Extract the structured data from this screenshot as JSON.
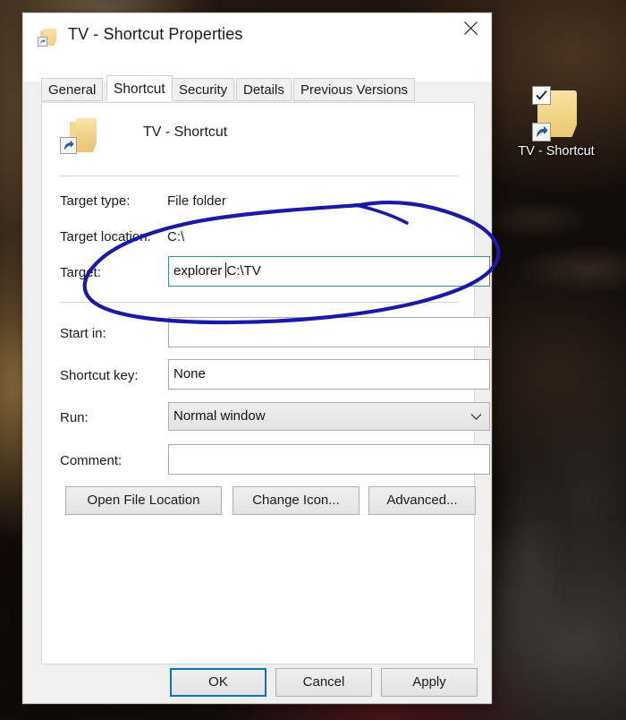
{
  "desktop": {
    "icon": {
      "label": "TV - Shortcut",
      "selected_icon": "checkmark-icon",
      "overlay_icon": "shortcut-arrow-icon",
      "base_icon": "folder-icon"
    },
    "wallpaper_colors": {
      "base": "#1a1210",
      "amber": "#8a6a3a",
      "dark": "#0d0908",
      "red_accent": "#4a1418"
    }
  },
  "dialog": {
    "title": "TV - Shortcut Properties",
    "title_icon": "folder-shortcut-icon",
    "close_icon": "close-icon",
    "tabs": [
      {
        "label": "General",
        "active": false
      },
      {
        "label": "Shortcut",
        "active": true
      },
      {
        "label": "Security",
        "active": false
      },
      {
        "label": "Details",
        "active": false
      },
      {
        "label": "Previous Versions",
        "active": false
      }
    ],
    "shortcut_tab": {
      "header_icon": "folder-shortcut-icon",
      "header_name": "TV - Shortcut",
      "fields": {
        "target_type": {
          "label": "Target type:",
          "value": "File folder"
        },
        "target_location": {
          "label": "Target location:",
          "value": "C:\\"
        },
        "target": {
          "label": "Target:",
          "value_before_caret": "explorer ",
          "value_after_caret": "C:\\TV",
          "full_value": "explorer C:\\TV",
          "focused": true,
          "focus_border_color": "#3a8ea0"
        },
        "start_in": {
          "label": "Start in:",
          "value": ""
        },
        "shortcut_key": {
          "label": "Shortcut key:",
          "value": "None"
        },
        "run": {
          "label": "Run:",
          "value": "Normal window",
          "chevron_icon": "chevron-down-icon"
        },
        "comment": {
          "label": "Comment:",
          "value": ""
        }
      },
      "buttons": [
        {
          "label": "Open File Location"
        },
        {
          "label": "Change Icon..."
        },
        {
          "label": "Advanced..."
        }
      ]
    },
    "footer_buttons": [
      {
        "label": "OK",
        "default": true
      },
      {
        "label": "Cancel",
        "default": false
      },
      {
        "label": "Apply",
        "default": false
      }
    ]
  },
  "annotation": {
    "shape": "hand-drawn-ellipse",
    "color": "#1a1aa8",
    "stroke_width": 4,
    "encircles": "target-field-row"
  }
}
